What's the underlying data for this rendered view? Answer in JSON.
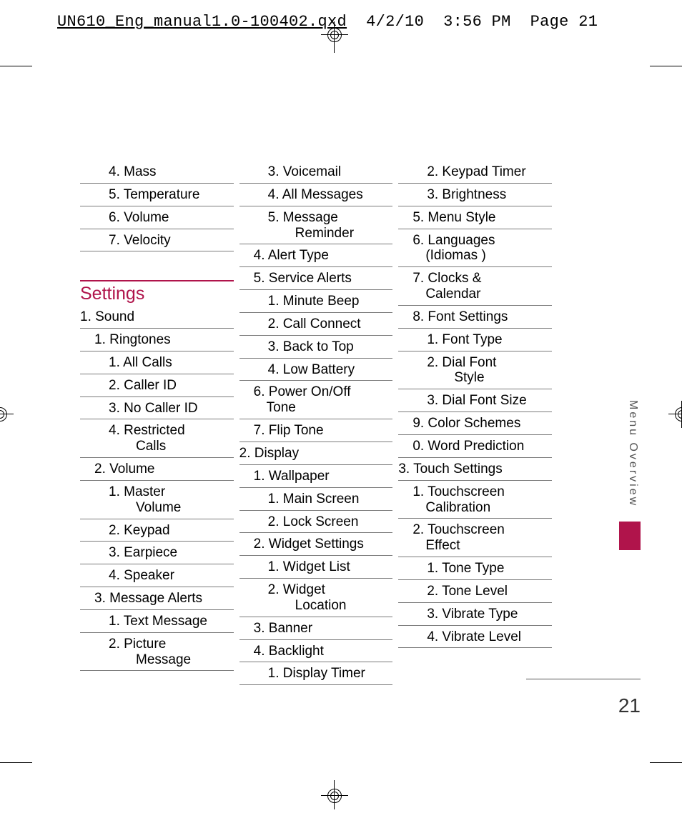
{
  "slug": {
    "filename": "UN610_Eng_manual1.0-100402.qxd",
    "date": "4/2/10",
    "time": "3:56 PM",
    "pageword": "Page",
    "pagenum_inline": "21"
  },
  "side_label": "Menu Overview",
  "page_number": "21",
  "settings_heading": "Settings",
  "items": [
    {
      "depth": 2,
      "text": "4. Mass"
    },
    {
      "depth": 2,
      "text": "5. Temperature"
    },
    {
      "depth": 2,
      "text": "6. Volume"
    },
    {
      "depth": 2,
      "text": "7. Velocity"
    },
    {
      "gap": true
    },
    {
      "section": true
    },
    {
      "depth": 0,
      "text": "1. Sound"
    },
    {
      "depth": 1,
      "text": "1. Ringtones"
    },
    {
      "depth": 2,
      "text": "1. All Calls"
    },
    {
      "depth": 2,
      "text": "2. Caller ID"
    },
    {
      "depth": 2,
      "text": "3. No Caller ID"
    },
    {
      "depth": 2,
      "text": "4. Restricted",
      "wrap": "Calls"
    },
    {
      "depth": 1,
      "text": "2. Volume"
    },
    {
      "depth": 2,
      "text": "1. Master",
      "wrap": "Volume"
    },
    {
      "depth": 2,
      "text": "2. Keypad"
    },
    {
      "depth": 2,
      "text": "3. Earpiece"
    },
    {
      "depth": 2,
      "text": "4. Speaker"
    },
    {
      "depth": 1,
      "text": "3. Message Alerts"
    },
    {
      "depth": 2,
      "text": "1. Text Message"
    },
    {
      "depth": 2,
      "text": "2. Picture",
      "wrap": "Message"
    },
    {
      "depth": 2,
      "text": "3. Voicemail"
    },
    {
      "depth": 2,
      "text": "4. All Messages"
    },
    {
      "depth": 2,
      "text": "5. Message",
      "wrap": "Reminder"
    },
    {
      "depth": 1,
      "text": "4. Alert Type"
    },
    {
      "depth": 1,
      "text": "5. Service Alerts"
    },
    {
      "depth": 2,
      "text": "1. Minute Beep"
    },
    {
      "depth": 2,
      "text": "2. Call Connect"
    },
    {
      "depth": 2,
      "text": "3. Back to Top"
    },
    {
      "depth": 2,
      "text": "4. Low Battery"
    },
    {
      "depth": 1,
      "text": "6. Power On/Off",
      "wrap1": "Tone"
    },
    {
      "depth": 1,
      "text": "7. Flip Tone"
    },
    {
      "depth": 0,
      "text": "2. Display"
    },
    {
      "depth": 1,
      "text": "1. Wallpaper"
    },
    {
      "depth": 2,
      "text": "1. Main Screen"
    },
    {
      "depth": 2,
      "text": "2. Lock Screen"
    },
    {
      "depth": 1,
      "text": "2. Widget Settings"
    },
    {
      "depth": 2,
      "text": "1. Widget List"
    },
    {
      "depth": 2,
      "text": "2. Widget",
      "wrap": "Location"
    },
    {
      "depth": 1,
      "text": "3. Banner"
    },
    {
      "depth": 1,
      "text": "4. Backlight"
    },
    {
      "depth": 2,
      "text": "1. Display Timer"
    },
    {
      "depth": 2,
      "text": "2. Keypad Timer"
    },
    {
      "depth": 2,
      "text": "3. Brightness"
    },
    {
      "depth": 1,
      "text": "5. Menu Style"
    },
    {
      "depth": 1,
      "text": "6. Languages",
      "wrap1": "(Idiomas )"
    },
    {
      "depth": 1,
      "text": "7. Clocks &",
      "wrap1": "Calendar"
    },
    {
      "depth": 1,
      "text": "8. Font Settings"
    },
    {
      "depth": 2,
      "text": "1. Font Type"
    },
    {
      "depth": 2,
      "text": "2. Dial Font",
      "wrap": "Style"
    },
    {
      "depth": 2,
      "text": "3. Dial Font Size"
    },
    {
      "depth": 1,
      "text": "9. Color Schemes"
    },
    {
      "depth": 1,
      "text": "0. Word Prediction"
    },
    {
      "depth": 0,
      "text": "3. Touch Settings"
    },
    {
      "depth": 1,
      "text": "1. Touchscreen",
      "wrap1": "Calibration"
    },
    {
      "depth": 1,
      "text": "2. Touchscreen",
      "wrap1": "Effect"
    },
    {
      "depth": 2,
      "text": "1. Tone Type"
    },
    {
      "depth": 2,
      "text": "2. Tone Level"
    },
    {
      "depth": 2,
      "text": "3. Vibrate Type"
    },
    {
      "depth": 2,
      "text": "4. Vibrate Level"
    }
  ]
}
